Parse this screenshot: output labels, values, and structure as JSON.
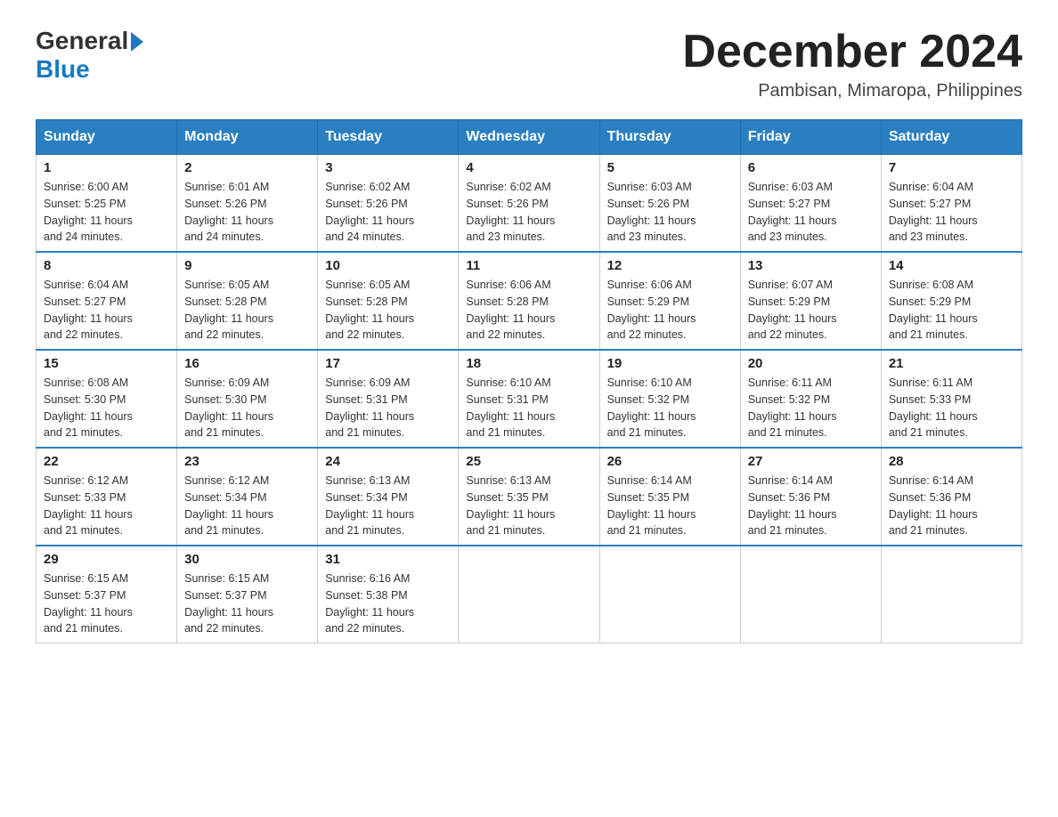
{
  "header": {
    "logo_general": "General",
    "logo_blue": "Blue",
    "month_title": "December 2024",
    "location": "Pambisan, Mimaropa, Philippines"
  },
  "days_of_week": [
    "Sunday",
    "Monday",
    "Tuesday",
    "Wednesday",
    "Thursday",
    "Friday",
    "Saturday"
  ],
  "weeks": [
    [
      {
        "day": "1",
        "sunrise": "6:00 AM",
        "sunset": "5:25 PM",
        "daylight": "11 hours and 24 minutes."
      },
      {
        "day": "2",
        "sunrise": "6:01 AM",
        "sunset": "5:26 PM",
        "daylight": "11 hours and 24 minutes."
      },
      {
        "day": "3",
        "sunrise": "6:02 AM",
        "sunset": "5:26 PM",
        "daylight": "11 hours and 24 minutes."
      },
      {
        "day": "4",
        "sunrise": "6:02 AM",
        "sunset": "5:26 PM",
        "daylight": "11 hours and 23 minutes."
      },
      {
        "day": "5",
        "sunrise": "6:03 AM",
        "sunset": "5:26 PM",
        "daylight": "11 hours and 23 minutes."
      },
      {
        "day": "6",
        "sunrise": "6:03 AM",
        "sunset": "5:27 PM",
        "daylight": "11 hours and 23 minutes."
      },
      {
        "day": "7",
        "sunrise": "6:04 AM",
        "sunset": "5:27 PM",
        "daylight": "11 hours and 23 minutes."
      }
    ],
    [
      {
        "day": "8",
        "sunrise": "6:04 AM",
        "sunset": "5:27 PM",
        "daylight": "11 hours and 22 minutes."
      },
      {
        "day": "9",
        "sunrise": "6:05 AM",
        "sunset": "5:28 PM",
        "daylight": "11 hours and 22 minutes."
      },
      {
        "day": "10",
        "sunrise": "6:05 AM",
        "sunset": "5:28 PM",
        "daylight": "11 hours and 22 minutes."
      },
      {
        "day": "11",
        "sunrise": "6:06 AM",
        "sunset": "5:28 PM",
        "daylight": "11 hours and 22 minutes."
      },
      {
        "day": "12",
        "sunrise": "6:06 AM",
        "sunset": "5:29 PM",
        "daylight": "11 hours and 22 minutes."
      },
      {
        "day": "13",
        "sunrise": "6:07 AM",
        "sunset": "5:29 PM",
        "daylight": "11 hours and 22 minutes."
      },
      {
        "day": "14",
        "sunrise": "6:08 AM",
        "sunset": "5:29 PM",
        "daylight": "11 hours and 21 minutes."
      }
    ],
    [
      {
        "day": "15",
        "sunrise": "6:08 AM",
        "sunset": "5:30 PM",
        "daylight": "11 hours and 21 minutes."
      },
      {
        "day": "16",
        "sunrise": "6:09 AM",
        "sunset": "5:30 PM",
        "daylight": "11 hours and 21 minutes."
      },
      {
        "day": "17",
        "sunrise": "6:09 AM",
        "sunset": "5:31 PM",
        "daylight": "11 hours and 21 minutes."
      },
      {
        "day": "18",
        "sunrise": "6:10 AM",
        "sunset": "5:31 PM",
        "daylight": "11 hours and 21 minutes."
      },
      {
        "day": "19",
        "sunrise": "6:10 AM",
        "sunset": "5:32 PM",
        "daylight": "11 hours and 21 minutes."
      },
      {
        "day": "20",
        "sunrise": "6:11 AM",
        "sunset": "5:32 PM",
        "daylight": "11 hours and 21 minutes."
      },
      {
        "day": "21",
        "sunrise": "6:11 AM",
        "sunset": "5:33 PM",
        "daylight": "11 hours and 21 minutes."
      }
    ],
    [
      {
        "day": "22",
        "sunrise": "6:12 AM",
        "sunset": "5:33 PM",
        "daylight": "11 hours and 21 minutes."
      },
      {
        "day": "23",
        "sunrise": "6:12 AM",
        "sunset": "5:34 PM",
        "daylight": "11 hours and 21 minutes."
      },
      {
        "day": "24",
        "sunrise": "6:13 AM",
        "sunset": "5:34 PM",
        "daylight": "11 hours and 21 minutes."
      },
      {
        "day": "25",
        "sunrise": "6:13 AM",
        "sunset": "5:35 PM",
        "daylight": "11 hours and 21 minutes."
      },
      {
        "day": "26",
        "sunrise": "6:14 AM",
        "sunset": "5:35 PM",
        "daylight": "11 hours and 21 minutes."
      },
      {
        "day": "27",
        "sunrise": "6:14 AM",
        "sunset": "5:36 PM",
        "daylight": "11 hours and 21 minutes."
      },
      {
        "day": "28",
        "sunrise": "6:14 AM",
        "sunset": "5:36 PM",
        "daylight": "11 hours and 21 minutes."
      }
    ],
    [
      {
        "day": "29",
        "sunrise": "6:15 AM",
        "sunset": "5:37 PM",
        "daylight": "11 hours and 21 minutes."
      },
      {
        "day": "30",
        "sunrise": "6:15 AM",
        "sunset": "5:37 PM",
        "daylight": "11 hours and 22 minutes."
      },
      {
        "day": "31",
        "sunrise": "6:16 AM",
        "sunset": "5:38 PM",
        "daylight": "11 hours and 22 minutes."
      },
      null,
      null,
      null,
      null
    ]
  ],
  "labels": {
    "sunrise": "Sunrise:",
    "sunset": "Sunset:",
    "daylight": "Daylight:"
  }
}
